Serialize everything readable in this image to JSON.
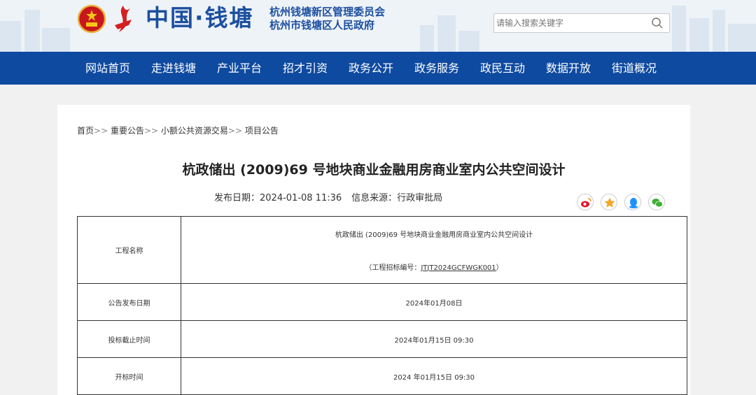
{
  "header": {
    "site_name": "中国·钱塘",
    "org_line1": "杭州钱塘新区管理委员会",
    "org_line2": "杭州市钱塘区人民政府",
    "search_placeholder": "请输入搜索关键字",
    "search_icon": "search-icon",
    "emblem_icon": "national-emblem-icon",
    "flame_icon": "red-flame-logo-icon"
  },
  "nav": {
    "items": [
      "网站首页",
      "走进钱塘",
      "产业平台",
      "招才引资",
      "政务公开",
      "政务服务",
      "政民互动",
      "数据开放",
      "街道概况"
    ],
    "bg_color": "#0e4aa0"
  },
  "breadcrumb": {
    "items": [
      "首页",
      "重要公告",
      "小额公共资源交易",
      "项目公告"
    ],
    "separator": ">>"
  },
  "article": {
    "title": "杭政储出 (2009)69 号地块商业金融用房商业室内公共空间设计",
    "publish_label": "发布日期：2024-01-08 11:36",
    "source_label": "信息来源：行政审批局"
  },
  "share": {
    "icons": [
      "weibo-icon",
      "star-icon",
      "qq-icon",
      "wechat-icon"
    ]
  },
  "table": {
    "rows": [
      {
        "label": "工程名称",
        "value": "杭政储出 (2009)69 号地块商业金融用房商业室内公共空间设计",
        "sub_prefix": "（工程招标编号：",
        "sub_code": "JTJT2024GCFWGK001",
        "sub_suffix": "）"
      },
      {
        "label": "公告发布日期",
        "value": "2024年01月08日"
      },
      {
        "label": "投标截止时间",
        "value": "2024年01月15日 09:30"
      },
      {
        "label": "开标时间",
        "value": "2024 年01月15日 09:30"
      }
    ]
  }
}
